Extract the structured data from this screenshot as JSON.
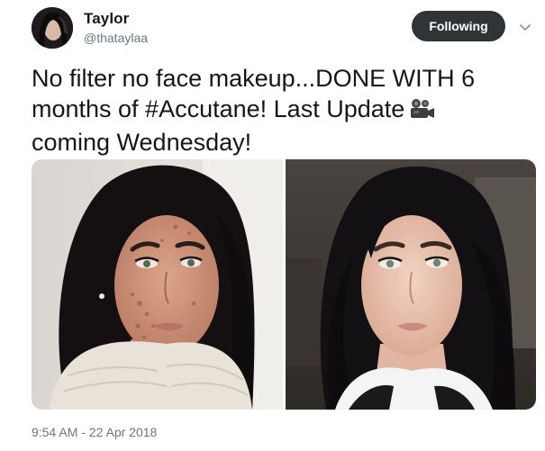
{
  "user": {
    "name": "Taylor",
    "handle": "@thataylaa"
  },
  "follow_button": {
    "label": "Following"
  },
  "tweet": {
    "text": "No filter no face makeup...DONE WITH 6 months of #Accutane! Last Update",
    "text_tail": "coming Wednesday!",
    "emoji_icon": "movie-camera-icon",
    "timestamp": "9:54 AM - 22 Apr 2018"
  },
  "colors": {
    "button_bg": "#303437",
    "secondary_text": "#657786",
    "primary_text": "#14171a"
  }
}
